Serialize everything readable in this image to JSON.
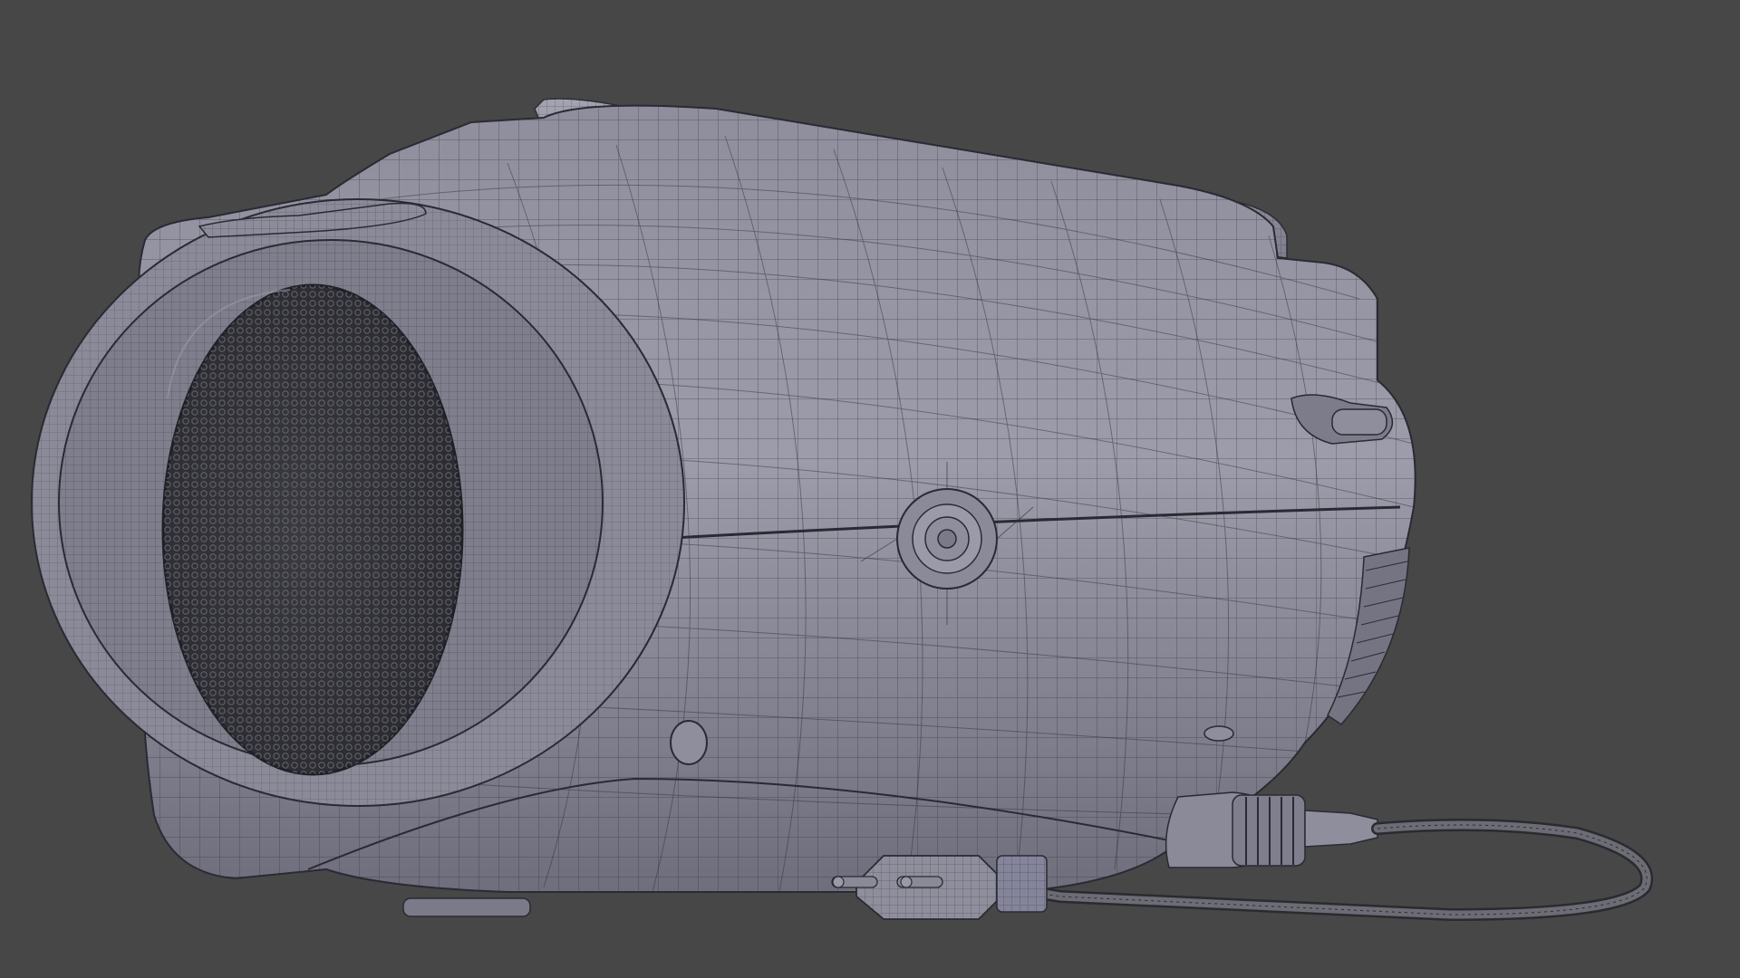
{
  "viewport": {
    "background": "#474747",
    "shading": "solid-wireframe-overlay",
    "object": "portable-boombox-radio-mesh"
  },
  "colors": {
    "body_light": "#9a9aa6",
    "body_mid": "#85859a",
    "body_dark": "#5f5f6d",
    "grille": "#3e3e44",
    "wire": "#2d2d38",
    "cable": "#6a6a70"
  },
  "icons": [
    "radio-body",
    "speaker-grille",
    "top-handle",
    "side-knob",
    "antenna-socket",
    "front-foot",
    "power-plug",
    "power-cable",
    "aux-connector"
  ]
}
